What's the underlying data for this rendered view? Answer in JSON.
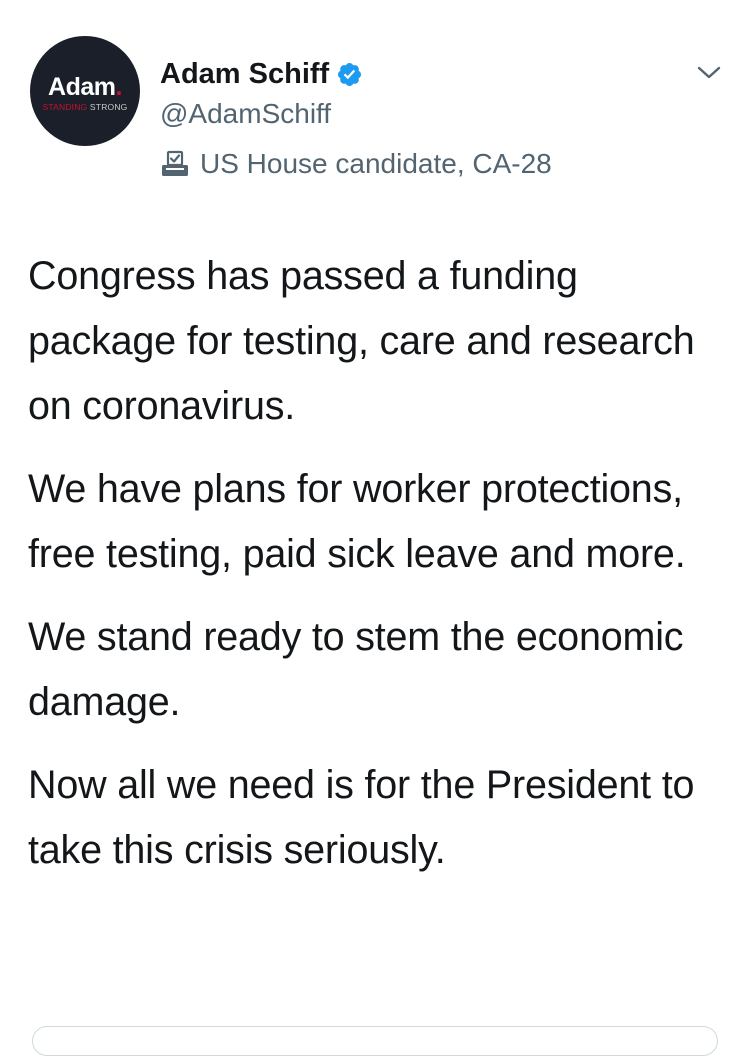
{
  "author": {
    "display_name": "Adam Schiff",
    "handle": "@AdamSchiff",
    "label": "US House candidate, CA-28",
    "verified": true,
    "avatar": {
      "main": "Adam",
      "dot": ".",
      "sub_red": "STANDING",
      "sub_gray": " STRONG"
    }
  },
  "icons": {
    "verified": "verified-badge-icon",
    "label": "ballot-box-icon",
    "menu": "chevron-down-icon"
  },
  "colors": {
    "text": "#14171a",
    "secondary": "#536471",
    "verified": "#1d9bf0",
    "avatar_bg": "#1b1f2a",
    "avatar_accent": "#c8102e"
  },
  "tweet": {
    "paragraphs": [
      "Congress has passed a funding package for testing, care and research on coronavirus.",
      "We have plans for worker protections, free testing, paid sick leave and more.",
      "We stand ready to stem the economic damage.",
      "Now all we need is for the President to take this crisis seriously."
    ]
  }
}
